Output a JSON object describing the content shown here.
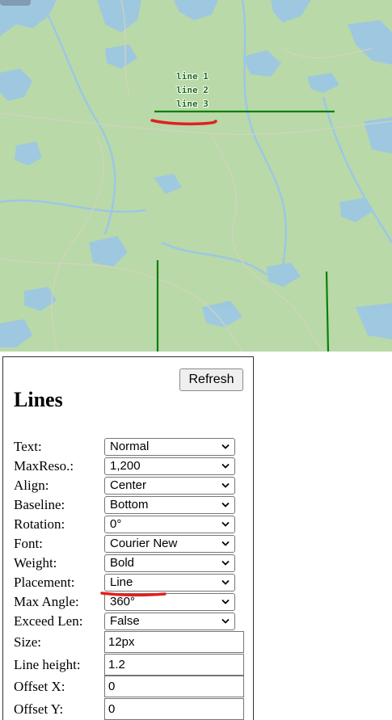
{
  "map": {
    "labels": [
      "line 1",
      "line 2",
      "line 3"
    ],
    "line_color": "#0a7f0a",
    "annotation_color": "#e02020"
  },
  "panel": {
    "refresh_label": "Refresh",
    "title": "Lines",
    "fields": [
      {
        "label": "Text:",
        "value": "Normal",
        "kind": "select"
      },
      {
        "label": "MaxReso.:",
        "value": "1,200",
        "kind": "select"
      },
      {
        "label": "Align:",
        "value": "Center",
        "kind": "select"
      },
      {
        "label": "Baseline:",
        "value": "Bottom",
        "kind": "select"
      },
      {
        "label": "Rotation:",
        "value": "0°",
        "kind": "select"
      },
      {
        "label": "Font:",
        "value": "Courier New",
        "kind": "select"
      },
      {
        "label": "Weight:",
        "value": "Bold",
        "kind": "select"
      },
      {
        "label": "Placement:",
        "value": "Line",
        "kind": "select"
      },
      {
        "label": "Max Angle:",
        "value": "360°",
        "kind": "select"
      },
      {
        "label": "Exceed Len:",
        "value": "False",
        "kind": "select"
      },
      {
        "label": "Size:",
        "value": "12px",
        "kind": "input"
      },
      {
        "label": "Line height:",
        "value": "1.2",
        "kind": "input"
      },
      {
        "label": "Offset X:",
        "value": "0",
        "kind": "input"
      },
      {
        "label": "Offset Y:",
        "value": "0",
        "kind": "input"
      }
    ]
  }
}
